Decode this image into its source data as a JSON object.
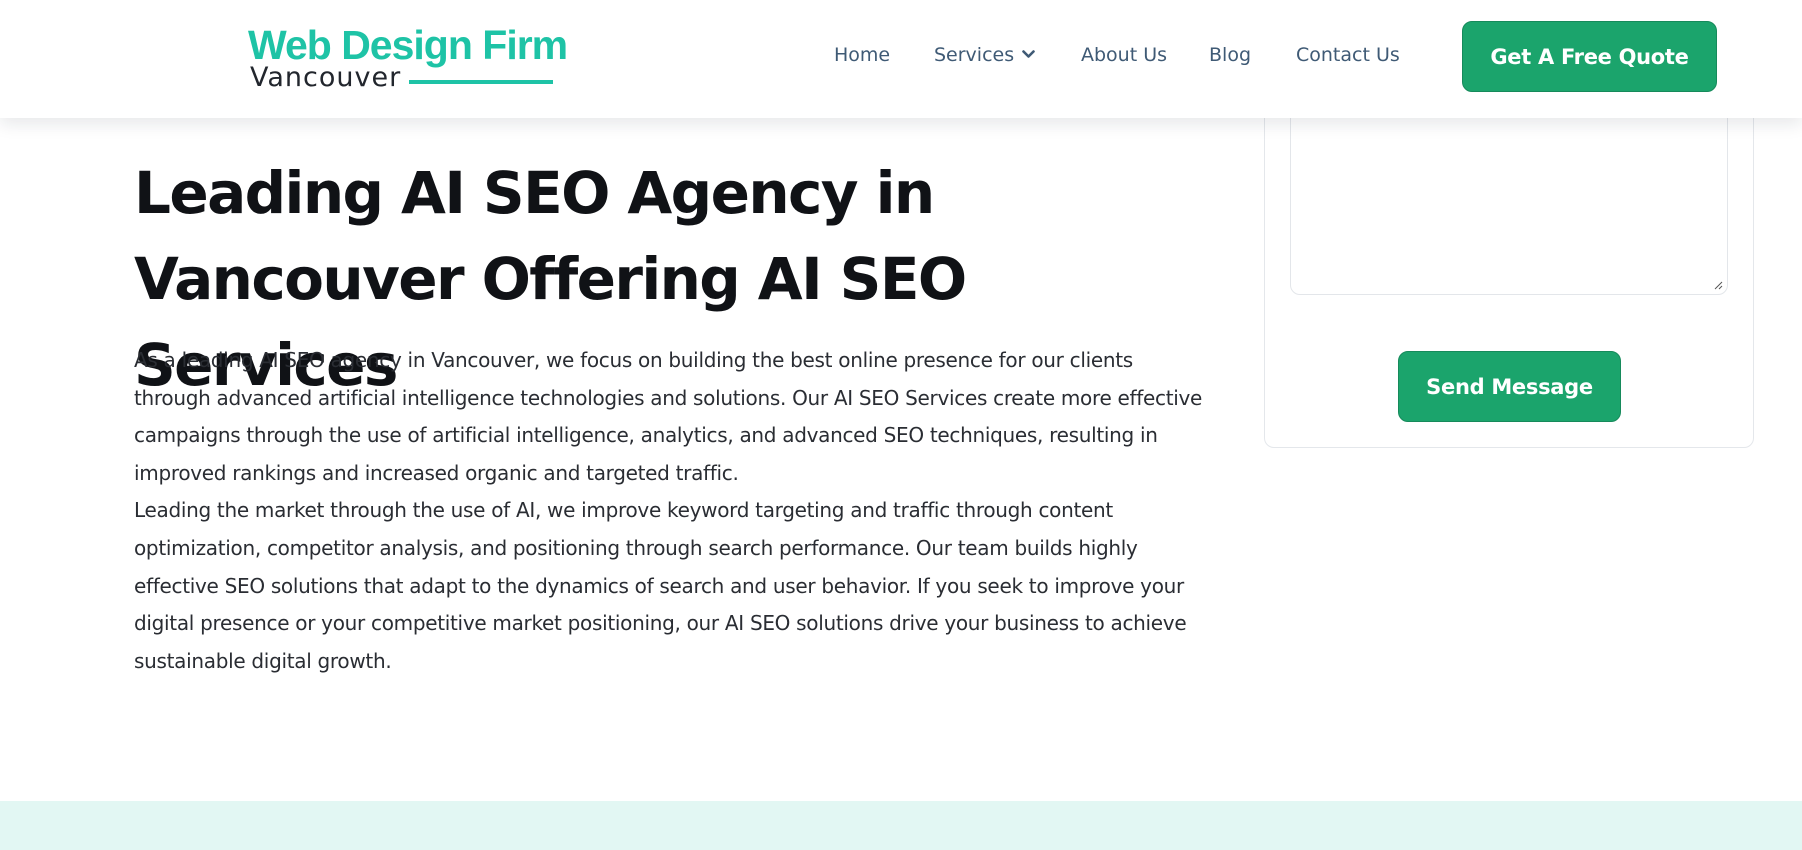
{
  "header": {
    "logo": {
      "line1": "Web Design Firm",
      "line2": "Vancouver"
    },
    "nav": [
      {
        "label": "Home"
      },
      {
        "label": "Services",
        "has_dropdown": true
      },
      {
        "label": "About Us"
      },
      {
        "label": "Blog"
      },
      {
        "label": "Contact Us"
      }
    ],
    "cta_label": "Get A Free Quote"
  },
  "hero": {
    "title": "Leading AI SEO Agency in Vancouver Offering AI SEO Services",
    "paragraphs": [
      "As a leading AI SEO agency in Vancouver, we focus on building the best online presence for our clients through advanced artificial intelligence technologies and solutions. Our AI SEO Services create more effective campaigns through the use of artificial intelligence, analytics, and advanced SEO techniques, resulting in improved rankings and increased organic and targeted traffic.",
      "Leading the market through the use of AI, we improve keyword targeting and traffic through content optimization, competitor analysis, and positioning through search performance. Our team builds highly effective SEO solutions that adapt to the dynamics of search and user behavior. If you seek to improve your digital presence or your competitive market positioning, our AI SEO solutions drive your business to achieve sustainable digital growth."
    ]
  },
  "form": {
    "message_value": "",
    "submit_label": "Send Message"
  },
  "colors": {
    "brand_teal": "#1ec3a6",
    "button_green": "#1ba46c",
    "nav_text": "#3f5a75",
    "band_bg": "#e2f7f3"
  },
  "icons": {
    "services_dropdown": "chevron-down-icon",
    "textarea_resize": "resize-grip-icon"
  }
}
